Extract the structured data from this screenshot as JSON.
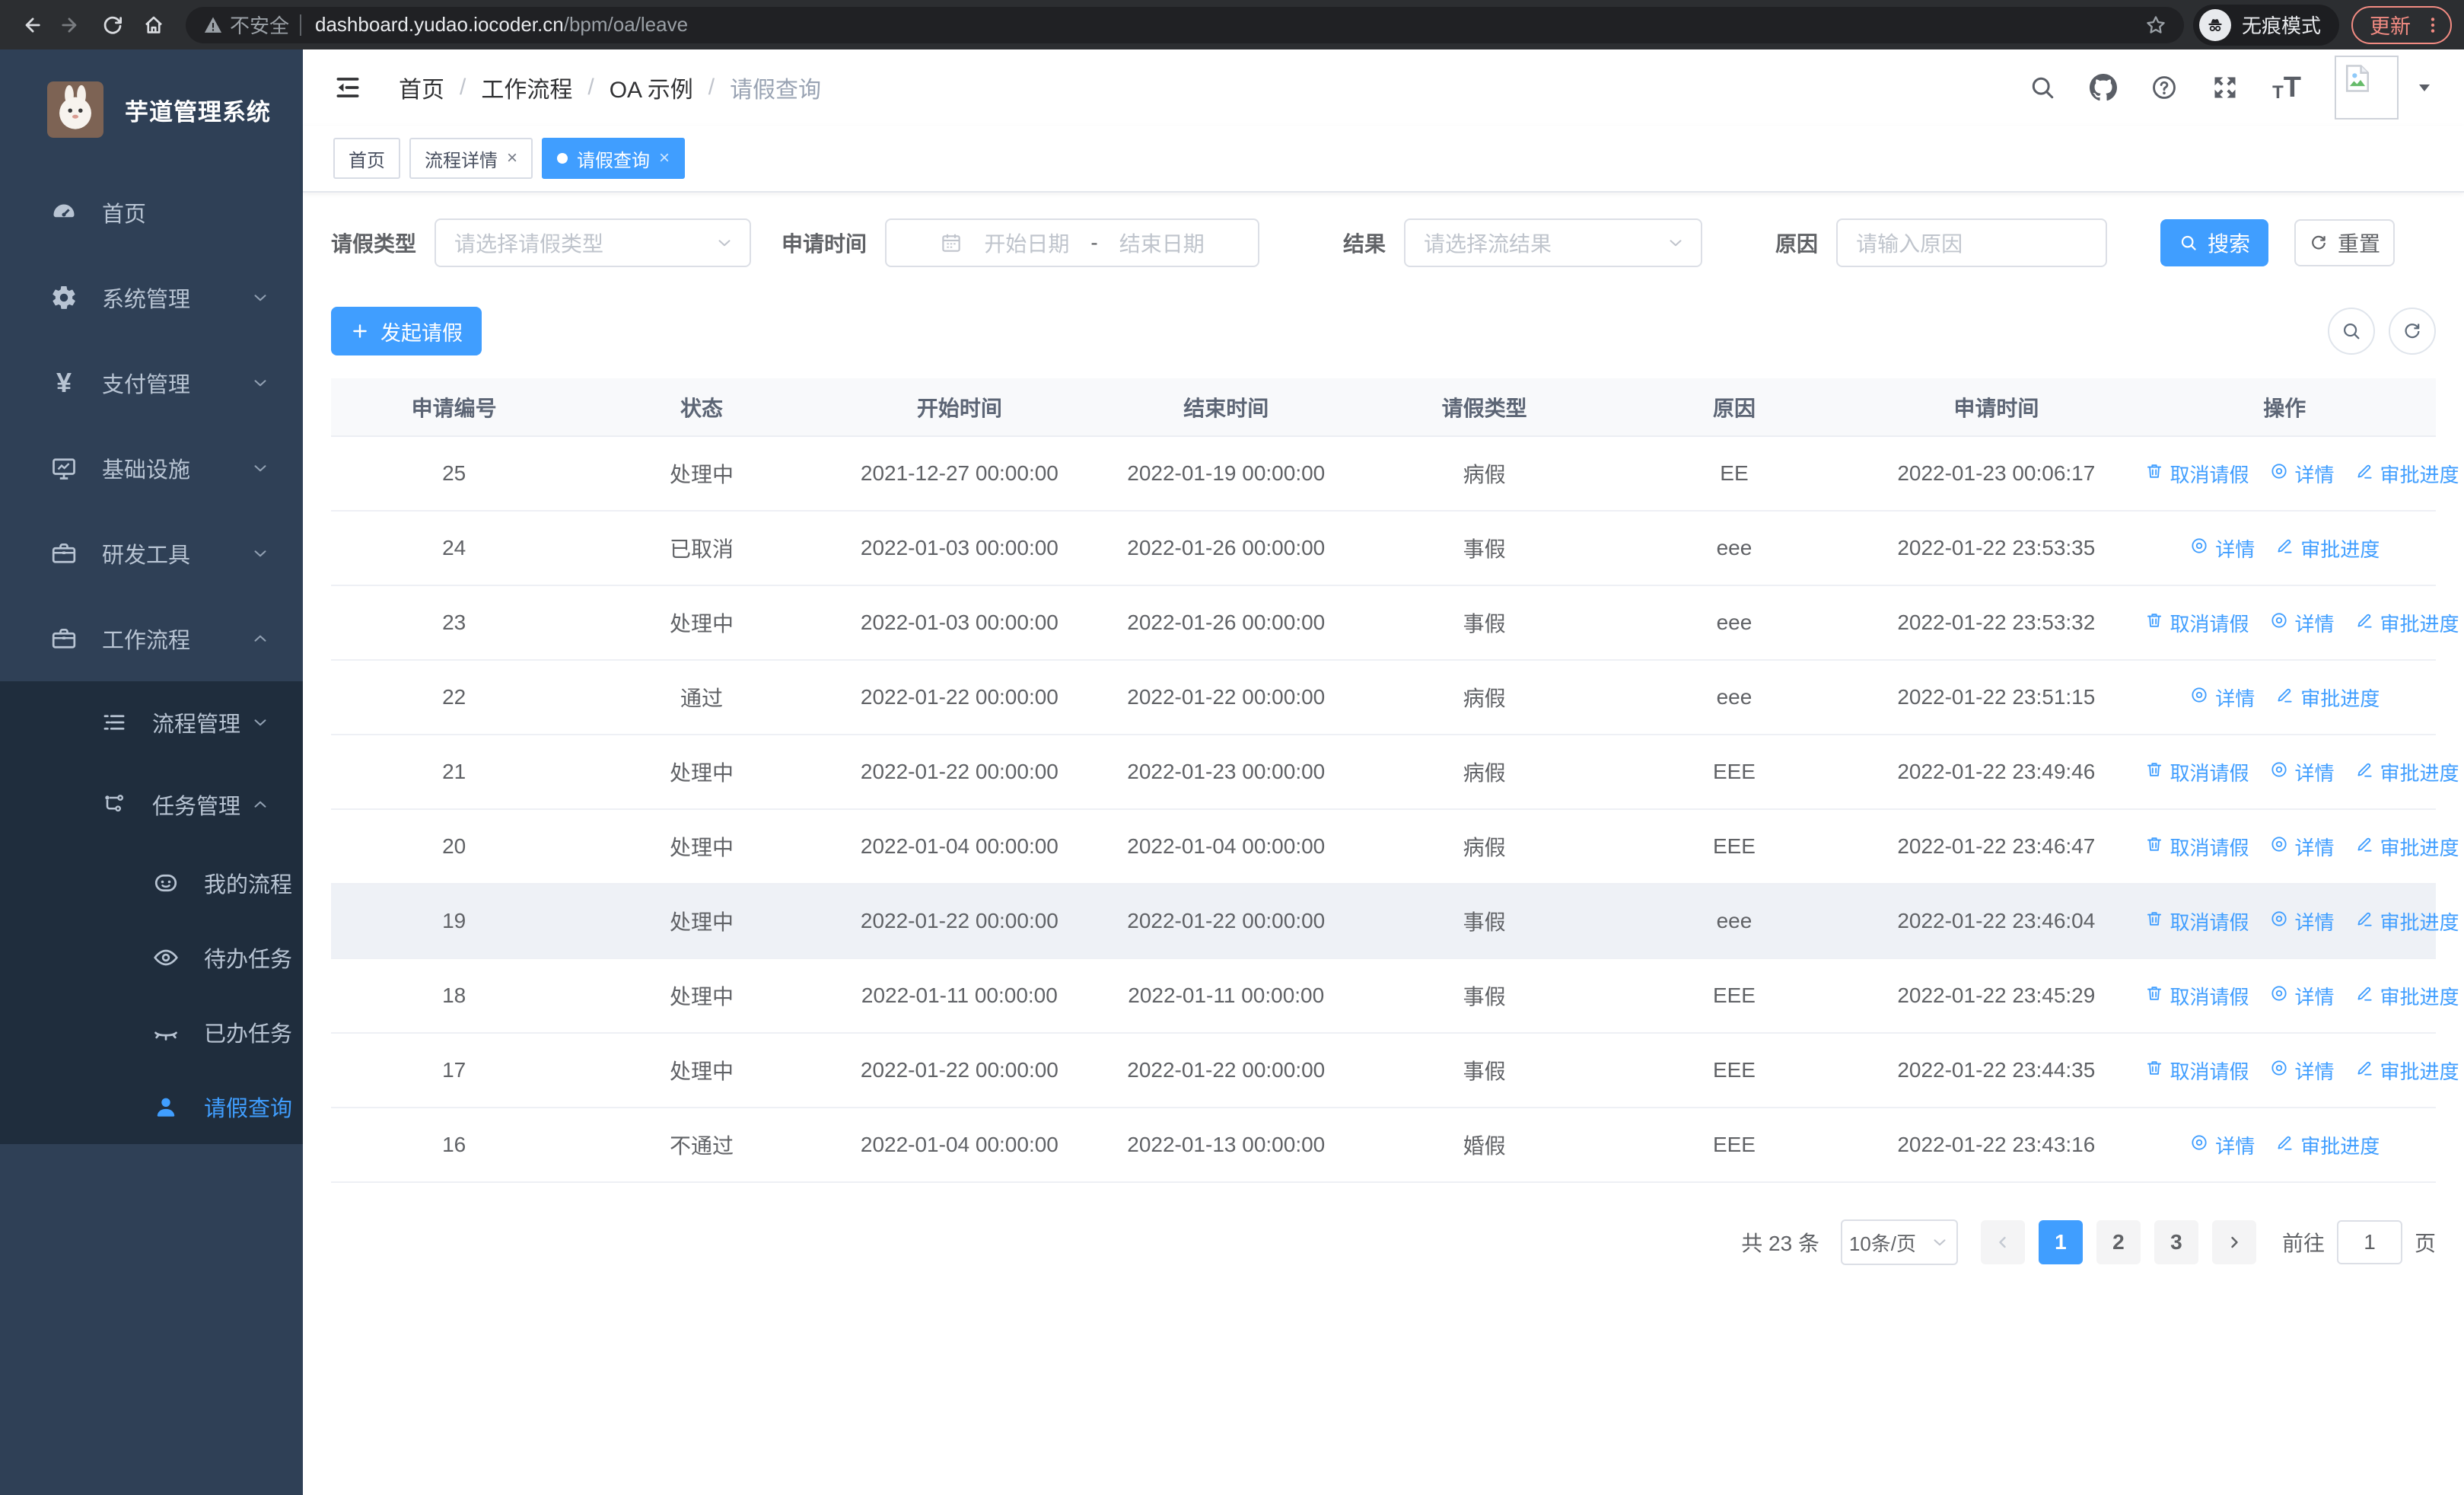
{
  "browser": {
    "security_label": "不安全",
    "url_host": "dashboard.yudao.iocoder.cn",
    "url_path": "/bpm/oa/leave",
    "incognito_label": "无痕模式",
    "update_label": "更新"
  },
  "sidebar": {
    "title": "芋道管理系统",
    "items": [
      {
        "key": "home",
        "label": "首页",
        "icon": "gauge-icon",
        "level": 1
      },
      {
        "key": "system",
        "label": "系统管理",
        "icon": "gear-icon",
        "level": 1,
        "arrow": "down"
      },
      {
        "key": "payment",
        "label": "支付管理",
        "icon": "yen-icon",
        "level": 1,
        "arrow": "down"
      },
      {
        "key": "infrastructure",
        "label": "基础设施",
        "icon": "monitor-icon",
        "level": 1,
        "arrow": "down"
      },
      {
        "key": "dev-tools",
        "label": "研发工具",
        "icon": "toolbox-icon",
        "level": 1,
        "arrow": "down"
      },
      {
        "key": "workflow",
        "label": "工作流程",
        "icon": "briefcase-icon",
        "level": 1,
        "arrow": "up"
      },
      {
        "key": "process-mgmt",
        "label": "流程管理",
        "icon": "list-icon",
        "level": 2,
        "arrow": "down",
        "sub": true
      },
      {
        "key": "task-mgmt",
        "label": "任务管理",
        "icon": "flow-icon",
        "level": 2,
        "arrow": "up",
        "sub": true
      },
      {
        "key": "my-process",
        "label": "我的流程",
        "icon": "robot-icon",
        "level": 3,
        "sub": true
      },
      {
        "key": "todo-tasks",
        "label": "待办任务",
        "icon": "eye-icon",
        "level": 3,
        "sub": true
      },
      {
        "key": "done-tasks",
        "label": "已办任务",
        "icon": "eye-closed-icon",
        "level": 3,
        "sub": true
      },
      {
        "key": "leave-query",
        "label": "请假查询",
        "icon": "user-icon",
        "level": 3,
        "sub": true,
        "active": true
      }
    ]
  },
  "breadcrumb": [
    {
      "key": "home",
      "label": "首页"
    },
    {
      "key": "workflow",
      "label": "工作流程"
    },
    {
      "key": "oa-example",
      "label": "OA 示例"
    },
    {
      "key": "leave-query",
      "label": "请假查询"
    }
  ],
  "tabs": [
    {
      "key": "home",
      "label": "首页"
    },
    {
      "key": "process-detail",
      "label": "流程详情",
      "closable": true
    },
    {
      "key": "leave-query",
      "label": "请假查询",
      "closable": true,
      "active": true
    }
  ],
  "filters": {
    "leave_type_label": "请假类型",
    "leave_type_placeholder": "请选择请假类型",
    "apply_time_label": "申请时间",
    "start_placeholder": "开始日期",
    "range_separator": "-",
    "end_placeholder": "结束日期",
    "result_label": "结果",
    "result_placeholder": "请选择流结果",
    "reason_label": "原因",
    "reason_placeholder": "请输入原因",
    "search_label": "搜索",
    "reset_label": "重置"
  },
  "toolbar": {
    "create_label": "发起请假"
  },
  "table": {
    "columns": [
      "申请编号",
      "状态",
      "开始时间",
      "结束时间",
      "请假类型",
      "原因",
      "申请时间",
      "操作"
    ],
    "action_defs": {
      "cancel": {
        "label": "取消请假",
        "icon": "trash-icon"
      },
      "detail": {
        "label": "详情",
        "icon": "view-icon"
      },
      "progress": {
        "label": "审批进度",
        "icon": "edit-icon"
      }
    },
    "rows": [
      {
        "id": "25",
        "status": "处理中",
        "start": "2021-12-27 00:00:00",
        "end": "2022-01-19 00:00:00",
        "type": "病假",
        "reason": "EE",
        "apply_time": "2022-01-23 00:06:17",
        "actions": [
          "cancel",
          "detail",
          "progress"
        ]
      },
      {
        "id": "24",
        "status": "已取消",
        "start": "2022-01-03 00:00:00",
        "end": "2022-01-26 00:00:00",
        "type": "事假",
        "reason": "eee",
        "apply_time": "2022-01-22 23:53:35",
        "actions": [
          "detail",
          "progress"
        ]
      },
      {
        "id": "23",
        "status": "处理中",
        "start": "2022-01-03 00:00:00",
        "end": "2022-01-26 00:00:00",
        "type": "事假",
        "reason": "eee",
        "apply_time": "2022-01-22 23:53:32",
        "actions": [
          "cancel",
          "detail",
          "progress"
        ]
      },
      {
        "id": "22",
        "status": "通过",
        "start": "2022-01-22 00:00:00",
        "end": "2022-01-22 00:00:00",
        "type": "病假",
        "reason": "eee",
        "apply_time": "2022-01-22 23:51:15",
        "actions": [
          "detail",
          "progress"
        ]
      },
      {
        "id": "21",
        "status": "处理中",
        "start": "2022-01-22 00:00:00",
        "end": "2022-01-23 00:00:00",
        "type": "病假",
        "reason": "EEE",
        "apply_time": "2022-01-22 23:49:46",
        "actions": [
          "cancel",
          "detail",
          "progress"
        ]
      },
      {
        "id": "20",
        "status": "处理中",
        "start": "2022-01-04 00:00:00",
        "end": "2022-01-04 00:00:00",
        "type": "病假",
        "reason": "EEE",
        "apply_time": "2022-01-22 23:46:47",
        "actions": [
          "cancel",
          "detail",
          "progress"
        ]
      },
      {
        "id": "19",
        "status": "处理中",
        "start": "2022-01-22 00:00:00",
        "end": "2022-01-22 00:00:00",
        "type": "事假",
        "reason": "eee",
        "apply_time": "2022-01-22 23:46:04",
        "actions": [
          "cancel",
          "detail",
          "progress"
        ],
        "highlighted": true
      },
      {
        "id": "18",
        "status": "处理中",
        "start": "2022-01-11 00:00:00",
        "end": "2022-01-11 00:00:00",
        "type": "事假",
        "reason": "EEE",
        "apply_time": "2022-01-22 23:45:29",
        "actions": [
          "cancel",
          "detail",
          "progress"
        ]
      },
      {
        "id": "17",
        "status": "处理中",
        "start": "2022-01-22 00:00:00",
        "end": "2022-01-22 00:00:00",
        "type": "事假",
        "reason": "EEE",
        "apply_time": "2022-01-22 23:44:35",
        "actions": [
          "cancel",
          "detail",
          "progress"
        ]
      },
      {
        "id": "16",
        "status": "不通过",
        "start": "2022-01-04 00:00:00",
        "end": "2022-01-13 00:00:00",
        "type": "婚假",
        "reason": "EEE",
        "apply_time": "2022-01-22 23:43:16",
        "actions": [
          "detail",
          "progress"
        ]
      }
    ]
  },
  "pagination": {
    "total_label": "共 23 条",
    "page_size_label": "10条/页",
    "pages": [
      "1",
      "2",
      "3"
    ],
    "current_page": "1",
    "goto_label": "前往",
    "goto_value": "1",
    "unit_label": "页"
  },
  "colors": {
    "accent": "#409eff",
    "sidebar_bg": "#2f4056",
    "submenu_bg": "#1f2d3d"
  }
}
